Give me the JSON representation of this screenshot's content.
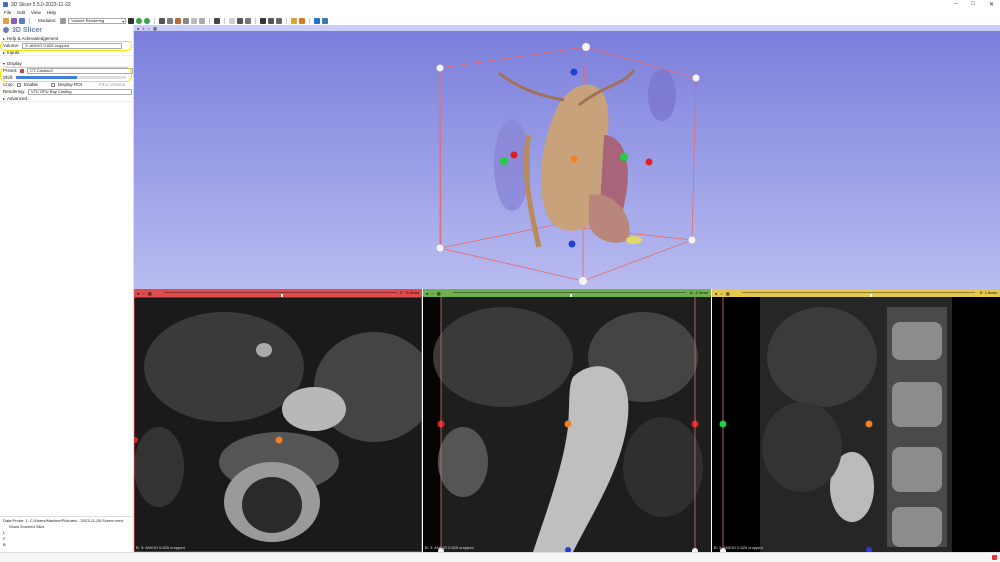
{
  "window": {
    "title": "3D Slicer 5.5.0-2023-11-22"
  },
  "menus": [
    "File",
    "Edit",
    "View",
    "Help"
  ],
  "toolbar": {
    "modules_label": "Modules:",
    "module_selected": "Volume Rendering"
  },
  "panel": {
    "logo": "3D Slicer",
    "sections": {
      "help": "Help & Acknowledgement",
      "inputs": "Inputs",
      "display": "Display",
      "advanced": "Advanced..."
    },
    "volume_label": "Volume:",
    "volume_value": "3: ANGIO 0.625 cropped",
    "preset_label": "Preset:",
    "preset_value": "CT-Cardiac3",
    "shift_label": "Shift:",
    "crop_label": "Crop:",
    "enable_label": "Enable",
    "display_roi_label": "Display ROI",
    "fit_label": "Fit to Volume",
    "rendering_label": "Rendering:",
    "rendering_value": "VTK GPU Ray Casting",
    "shift_fraction": 0.55
  },
  "probe": {
    "title": "Data Probe: 1: C:/Users/Maxime/Pictures/...2023-11-28-Scene.mrml",
    "show_zoomed": "Show Zoomed Slice",
    "lines": [
      "L",
      "F",
      "B"
    ]
  },
  "views": {
    "red": {
      "offset": "S: 71.5mm",
      "annotation": "B: 3: ANGIO 0.625 cropped",
      "thumb_fraction": 0.5
    },
    "green": {
      "offset": "A: -2.4mm",
      "annotation": "B: 3: ANGIO 0.625 cropped",
      "thumb_fraction": 0.5
    },
    "yellow": {
      "offset": "R: 1.6mm",
      "annotation": "B: 3: ANGIO 0.625 cropped",
      "thumb_fraction": 0.55
    }
  },
  "colors": {
    "red_view": "#e04b4b",
    "green_view": "#6fb04f",
    "yellow_view": "#e3c84a",
    "view3d_top": "#7a7dda"
  }
}
